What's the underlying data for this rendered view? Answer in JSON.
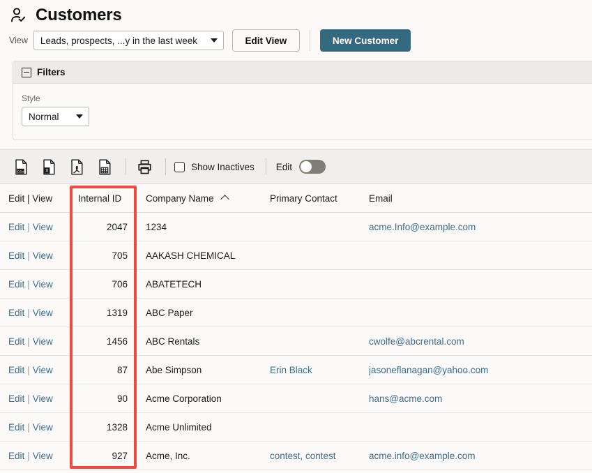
{
  "header": {
    "icon": "person-check-icon",
    "title": "Customers",
    "view_label": "View",
    "view_value": "Leads, prospects, ...y in the last week",
    "edit_view_label": "Edit View",
    "new_customer_label": "New Customer"
  },
  "filters": {
    "title": "Filters",
    "collapse_icon": "minus-box-icon",
    "style_label": "Style",
    "style_value": "Normal"
  },
  "toolbar": {
    "export_icons": [
      {
        "name": "export-csv-icon",
        "badge": "CSV"
      },
      {
        "name": "export-excel-icon",
        "badge": "X"
      },
      {
        "name": "export-pdf-icon",
        "badge": "PDF"
      },
      {
        "name": "export-spreadsheet-icon",
        "badge": "GRID"
      }
    ],
    "print_icon": "print-icon",
    "show_inactives_label": "Show Inactives",
    "show_inactives_checked": false,
    "edit_label": "Edit",
    "edit_toggle_on": false
  },
  "table": {
    "columns": [
      {
        "key": "actions",
        "label": "Edit | View"
      },
      {
        "key": "internal_id",
        "label": "Internal ID"
      },
      {
        "key": "company_name",
        "label": "Company Name",
        "sort": "asc",
        "sort_icon": "chevron-up-icon"
      },
      {
        "key": "primary_contact",
        "label": "Primary Contact"
      },
      {
        "key": "email",
        "label": "Email"
      }
    ],
    "edit_action": "Edit",
    "view_action": "View",
    "separator": "|",
    "rows": [
      {
        "internal_id": "2047",
        "company_name": "1234",
        "primary_contact": "",
        "email": "acme.Info@example.com"
      },
      {
        "internal_id": "705",
        "company_name": "AAKASH CHEMICAL",
        "primary_contact": "",
        "email": ""
      },
      {
        "internal_id": "706",
        "company_name": "ABATETECH",
        "primary_contact": "",
        "email": ""
      },
      {
        "internal_id": "1319",
        "company_name": "ABC Paper",
        "primary_contact": "",
        "email": ""
      },
      {
        "internal_id": "1456",
        "company_name": "ABC Rentals",
        "primary_contact": "",
        "email": "cwolfe@abcrental.com"
      },
      {
        "internal_id": "87",
        "company_name": "Abe Simpson",
        "primary_contact": "Erin Black",
        "email": "jasoneflanagan@yahoo.com"
      },
      {
        "internal_id": "90",
        "company_name": "Acme Corporation",
        "primary_contact": "",
        "email": "hans@acme.com"
      },
      {
        "internal_id": "1328",
        "company_name": "Acme Unlimited",
        "primary_contact": "",
        "email": ""
      },
      {
        "internal_id": "927",
        "company_name": "Acme, Inc.",
        "primary_contact": "contest, contest",
        "email": "acme.info@example.com"
      }
    ]
  },
  "annotation": {
    "name": "internal-id-column-highlight",
    "color": "#f04a45"
  },
  "colors": {
    "accent": "#35697f",
    "link": "#3f6b8f",
    "annotation": "#f04a45",
    "page_bg": "#fbfaf9",
    "toolbar_bg": "#f0efed",
    "panel_head_bg": "#edecea"
  }
}
